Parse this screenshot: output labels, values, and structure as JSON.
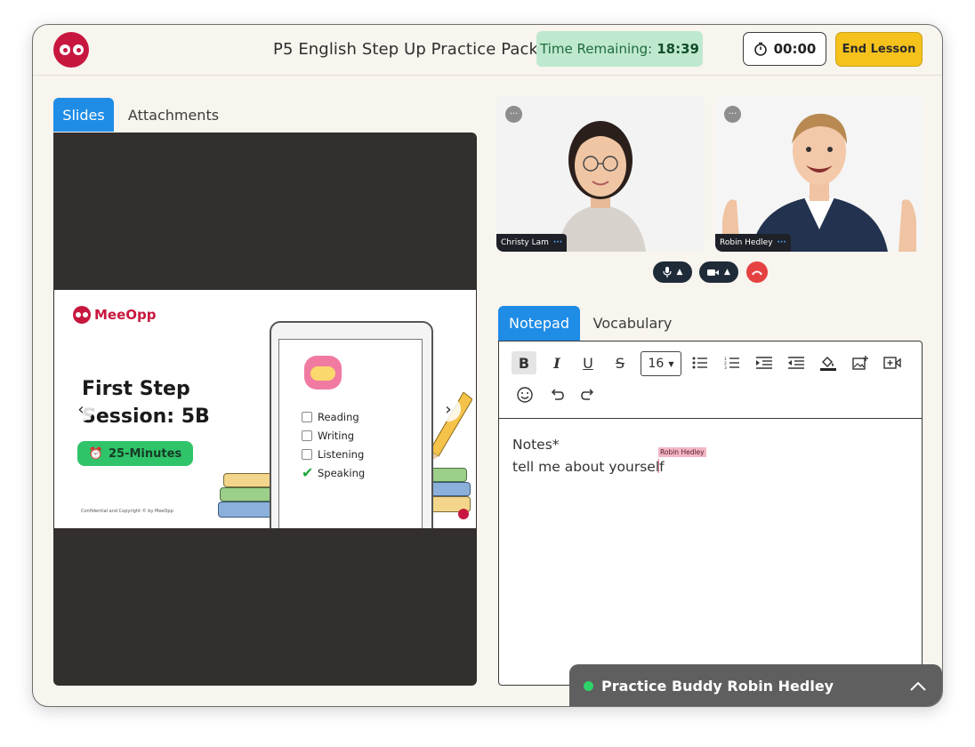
{
  "header": {
    "title": "P5 English Step Up Practice Pack",
    "time_remaining_label": "Time Remaining:",
    "time_remaining_value": "18:39",
    "timer": "00:00",
    "end_lesson": "End Lesson"
  },
  "left_tabs": [
    {
      "label": "Slides",
      "active": true
    },
    {
      "label": "Attachments",
      "active": false
    }
  ],
  "slide": {
    "brand": "MeeOpp",
    "title_line1": "First Step",
    "title_line2": "Session: 5B",
    "duration": "25-Minutes",
    "copyright": "Confidential and Copyright © by MeeOpp",
    "checklist": [
      {
        "label": "Reading",
        "checked": false
      },
      {
        "label": "Writing",
        "checked": false
      },
      {
        "label": "Listening",
        "checked": false
      },
      {
        "label": "Speaking",
        "checked": true
      }
    ]
  },
  "participants": [
    {
      "name": "Christy Lam"
    },
    {
      "name": "Robin Hedley"
    }
  ],
  "right_tabs": [
    {
      "label": "Notepad",
      "active": true
    },
    {
      "label": "Vocabulary",
      "active": false
    }
  ],
  "editor": {
    "font_size": "16",
    "line1": "Notes*",
    "line2": "tell me about yourself",
    "cursor_user": "Robin Hedley"
  },
  "buddy_bar": {
    "text": "Practice Buddy Robin Hedley"
  },
  "colors": {
    "accent_blue": "#1f8ce6",
    "brand_red": "#c8173f",
    "end_yellow": "#f5c21b",
    "time_green_bg": "#bfe9cf"
  }
}
